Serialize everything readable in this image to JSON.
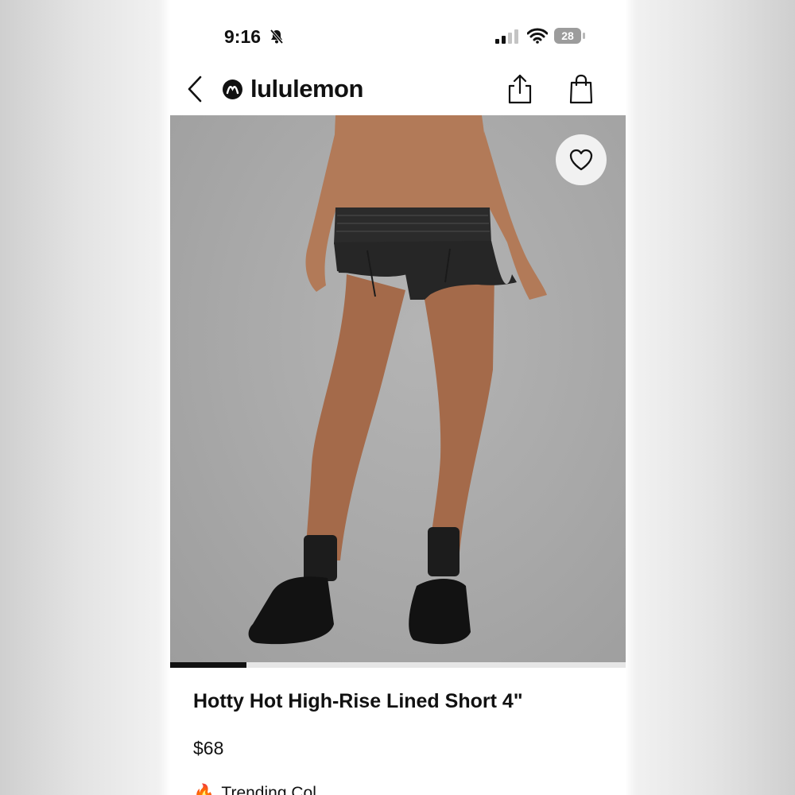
{
  "status_bar": {
    "time": "9:16",
    "battery": "28",
    "icons": [
      "bell-muted-icon",
      "cellular-signal-icon",
      "wifi-icon",
      "battery-icon"
    ]
  },
  "nav": {
    "brand": "lululemon",
    "icons": [
      "back-chevron-icon",
      "lululemon-logo",
      "share-icon",
      "shopping-bag-icon"
    ]
  },
  "product": {
    "image_alt": "Model wearing black high-rise lined shorts",
    "favorite_icon": "heart-icon",
    "carousel_position": 0.17,
    "title": "Hotty Hot High-Rise Lined Short 4\"",
    "price": "$68",
    "trending_icon": "fire-icon",
    "trending_text": "Trending Col"
  },
  "colors": {
    "text": "#111111",
    "image_background": "#a8a8a8",
    "shorts": "#262626",
    "skin": "#b27a58"
  }
}
